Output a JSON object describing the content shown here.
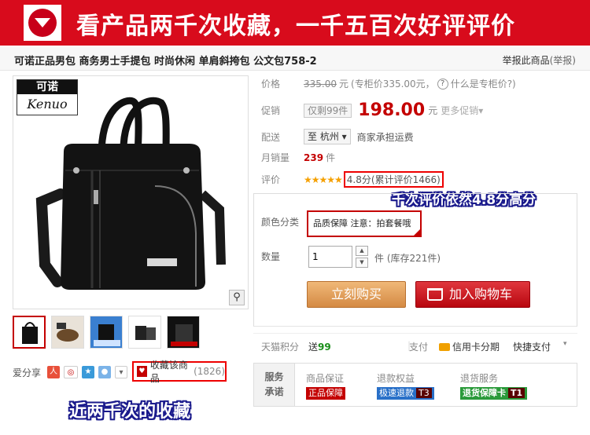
{
  "banner": {
    "text": "看产品两千次收藏，一千五百次好评评价"
  },
  "product": {
    "title": "可诺正品男包 商务男士手提包 时尚休闲 单肩斜挎包 公文包758-2",
    "report_label": "举报此商品",
    "report_paren": "(举报)"
  },
  "brand": {
    "cn": "可诺",
    "en": "Kenuo"
  },
  "price": {
    "label": "价格",
    "original": "335.00",
    "unit": "元",
    "counter_note": "(专柜价335.00元，",
    "counter_help": "什么是专柜价?)"
  },
  "promo": {
    "label": "促销",
    "tag": "仅剩99件",
    "price": "198.00",
    "unit": "元",
    "more": "更多促销▾"
  },
  "shipping": {
    "label": "配送",
    "location": "至 杭州 ▾",
    "note": "商家承担运费"
  },
  "sales": {
    "label": "月销量",
    "count": "239",
    "unit": "件"
  },
  "rating": {
    "label": "评价",
    "stars": "★★★★★",
    "text": "4.8分(累计评价1466)"
  },
  "callouts": {
    "rating_note": "千次评价依然4.8分高分",
    "fav_note": "近两千次的收藏"
  },
  "sku": {
    "color_label": "颜色分类",
    "color_option": "品质保障 注意：拍套餐哦",
    "qty_label": "数量",
    "qty_value": "1",
    "stock": "件 (库存221件)"
  },
  "buttons": {
    "buy": "立刻购买",
    "cart": "加入购物车"
  },
  "points": {
    "label": "天猫积分",
    "value_prefix": "送",
    "value": "99",
    "pay_label": "支付",
    "card": "信用卡分期",
    "fast": "快捷支付"
  },
  "share": {
    "label": "爱分享"
  },
  "favorite": {
    "label": "收藏该商品",
    "count": "(1826)"
  },
  "service": {
    "head": "服务\n承诺",
    "cols": [
      {
        "title": "商品保证",
        "tag": "正品保障",
        "suffix": ""
      },
      {
        "title": "退款权益",
        "tag": "极速退款",
        "suffix": "T3"
      },
      {
        "title": "退货服务",
        "tag": "退货保障卡",
        "suffix": "T1"
      }
    ]
  },
  "colors": {
    "brand_red": "#d80b1c",
    "price_red": "#c40000",
    "callout_outline": "#1a1a8c"
  }
}
